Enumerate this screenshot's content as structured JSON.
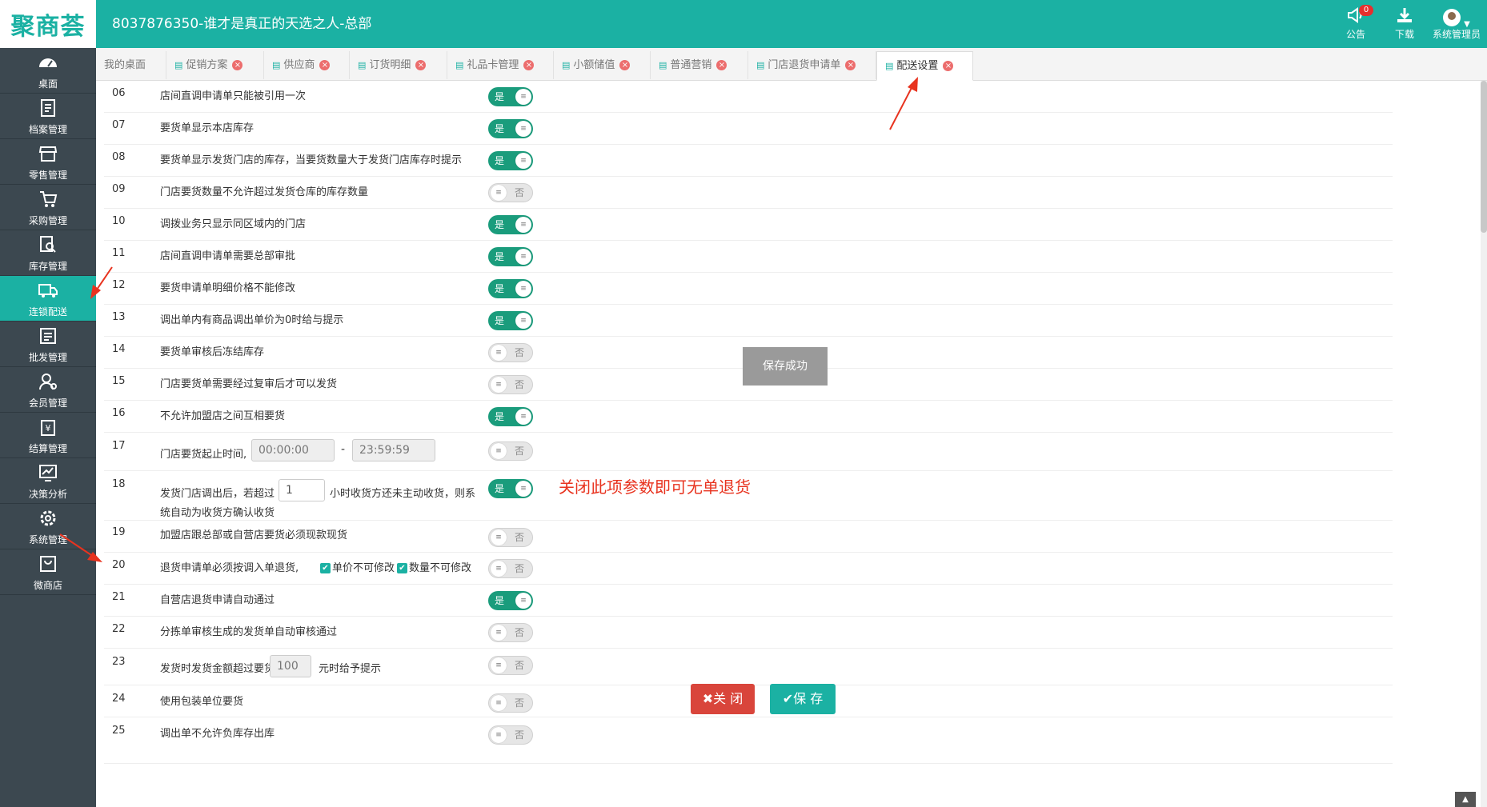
{
  "header": {
    "logo": "聚商荟",
    "title": "8037876350-谁才是真正的天选之人-总部",
    "notice_label": "公告",
    "notice_count": "0",
    "download_label": "下载",
    "user_label": "系统管理员"
  },
  "sidebar": {
    "items": [
      {
        "label": "桌面",
        "icon": "dashboard-icon"
      },
      {
        "label": "档案管理",
        "icon": "archive-icon"
      },
      {
        "label": "零售管理",
        "icon": "store-icon"
      },
      {
        "label": "采购管理",
        "icon": "cart-icon"
      },
      {
        "label": "库存管理",
        "icon": "inventory-icon"
      },
      {
        "label": "连锁配送",
        "icon": "truck-icon"
      },
      {
        "label": "批发管理",
        "icon": "wholesale-icon"
      },
      {
        "label": "会员管理",
        "icon": "member-icon"
      },
      {
        "label": "结算管理",
        "icon": "settlement-icon"
      },
      {
        "label": "决策分析",
        "icon": "chart-icon"
      },
      {
        "label": "系统管理",
        "icon": "gear-icon"
      },
      {
        "label": "微商店",
        "icon": "shop-bag-icon"
      }
    ]
  },
  "tabs": [
    {
      "label": "我的桌面"
    },
    {
      "label": "促销方案"
    },
    {
      "label": "供应商"
    },
    {
      "label": "订货明细"
    },
    {
      "label": "礼品卡管理"
    },
    {
      "label": "小额储值"
    },
    {
      "label": "普通营销"
    },
    {
      "label": "门店退货申请单"
    },
    {
      "label": "配送设置"
    }
  ],
  "settings": [
    {
      "num": "06",
      "label": "店间直调申请单只能被引用一次",
      "value": "是"
    },
    {
      "num": "07",
      "label": "要货单显示本店库存",
      "value": "是"
    },
    {
      "num": "08",
      "label": "要货单显示发货门店的库存，当要货数量大于发货门店库存时提示",
      "value": "是"
    },
    {
      "num": "09",
      "label": "门店要货数量不允许超过发货仓库的库存数量",
      "value": "否"
    },
    {
      "num": "10",
      "label": "调拨业务只显示同区域内的门店",
      "value": "是"
    },
    {
      "num": "11",
      "label": "店间直调申请单需要总部审批",
      "value": "是"
    },
    {
      "num": "12",
      "label": "要货申请单明细价格不能修改",
      "value": "是"
    },
    {
      "num": "13",
      "label": "调出单内有商品调出单价为0时给与提示",
      "value": "是"
    },
    {
      "num": "14",
      "label": "要货单审核后冻结库存",
      "value": "否"
    },
    {
      "num": "15",
      "label": "门店要货单需要经过复审后才可以发货",
      "value": "否"
    },
    {
      "num": "16",
      "label": "不允许加盟店之间互相要货",
      "value": "是"
    },
    {
      "num": "17",
      "label": "门店要货起止时间",
      "start": "00:00:00",
      "end": "23:59:59",
      "value": "否"
    },
    {
      "num": "18",
      "label_a": "发货门店调出后，若超过",
      "input": "1",
      "label_b": "小时收货方还未主动收货，则系",
      "label_c": "统自动为收货方确认收货",
      "value": "是"
    },
    {
      "num": "19",
      "label": "加盟店跟总部或自营店要货必须现款现货",
      "value": "否"
    },
    {
      "num": "20",
      "label": "退货申请单必须按调入单退货,",
      "opt1": "单价不可修改",
      "opt2": "数量不可修改",
      "value": "否"
    },
    {
      "num": "21",
      "label": "自营店退货申请自动通过",
      "value": "是"
    },
    {
      "num": "22",
      "label": "分拣单审核生成的发货单自动审核通过",
      "value": "否"
    },
    {
      "num": "23",
      "label_a": "发货时发货金额超过要货金额",
      "input": "100",
      "label_b": "元时给予提示",
      "value": "否"
    },
    {
      "num": "24",
      "label": "使用包装单位要货",
      "value": "否"
    },
    {
      "num": "25",
      "label": "调出单不允许负库存出库",
      "value": "否"
    }
  ],
  "annotation": "关闭此项参数即可无单退货",
  "toast": "保存成功",
  "footer": {
    "close_label": "✖关 闭",
    "save_label": "✔保 存"
  },
  "colors": {
    "brand": "#1bb1a3",
    "sidebar": "#3c4850",
    "toggle_on": "#1a9c7c",
    "danger": "#d9453b",
    "annotation": "#e8331f"
  }
}
